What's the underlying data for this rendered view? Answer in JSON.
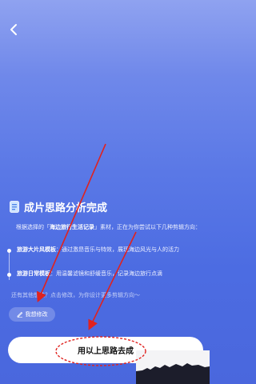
{
  "nav": {
    "back_icon": "chevron-left-icon"
  },
  "analysis": {
    "title": "成片思路分析完成",
    "intro_prefix": "根据选择的「",
    "intro_material": "海边旅行生活记录",
    "intro_suffix": "」素材，正在为你尝试以下几种剪辑方向：",
    "directions": [
      {
        "name": "旅游大片风模板",
        "desc": "：通过激昂音乐与特效，展现海边风光与人的活力"
      },
      {
        "name": "旅游日常模板",
        "desc": "：用温馨滤镜和舒缓音乐，记录海边旅行点滴"
      }
    ],
    "hint": "还有其他想法？点击修改，为你设计更多剪辑方向～"
  },
  "buttons": {
    "edit_label": "我想修改",
    "generate_label": "用以上思路去成"
  },
  "colors": {
    "background_top": "#8fa2f0",
    "background_bottom": "#4a67dd",
    "annotation_red": "#e0221f"
  }
}
